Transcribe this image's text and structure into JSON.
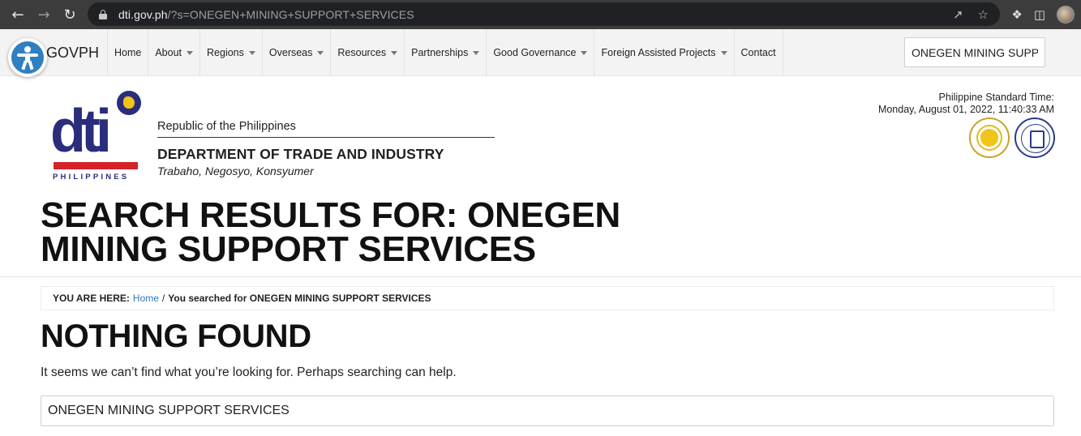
{
  "browser": {
    "url_host": "dti.gov.ph",
    "url_path": "/?s=ONEGEN+MINING+SUPPORT+SERVICES",
    "icons": [
      "back-arrow-icon",
      "forward-arrow-icon",
      "reload-icon",
      "lock-icon",
      "share-icon",
      "star-icon",
      "extensions-icon",
      "sidepanel-icon",
      "profile-avatar"
    ]
  },
  "govnav": {
    "brand": "GOVPH",
    "items": [
      {
        "label": "Home",
        "has_caret": false
      },
      {
        "label": "About",
        "has_caret": true
      },
      {
        "label": "Regions",
        "has_caret": true
      },
      {
        "label": "Overseas",
        "has_caret": true
      },
      {
        "label": "Resources",
        "has_caret": true
      },
      {
        "label": "Partnerships",
        "has_caret": true
      },
      {
        "label": "Good Governance",
        "has_caret": true
      },
      {
        "label": "Foreign Assisted Projects",
        "has_caret": true
      },
      {
        "label": "Contact",
        "has_caret": false
      }
    ],
    "search_value": "ONEGEN MINING SUPPORT SERVICES"
  },
  "header": {
    "logo_text": "dti",
    "logo_country": "PHILIPPINES",
    "republic": "Republic of the Philippines",
    "department": "DEPARTMENT OF TRADE AND INDUSTRY",
    "tagline": "Trabaho, Negosyo, Konsyumer",
    "pst_label": "Philippine Standard Time:",
    "pst_value": "Monday, August 01, 2022, 11:40:33 AM",
    "colors": {
      "navy": "#2a2d7c",
      "red": "#d3222a",
      "gold": "#f0c419"
    }
  },
  "page": {
    "title": "SEARCH RESULTS FOR: ONEGEN MINING SUPPORT SERVICES",
    "breadcrumb_prefix": "YOU ARE HERE:",
    "breadcrumb_home": "Home",
    "breadcrumb_sep": "/",
    "breadcrumb_current": "You searched for ONEGEN MINING SUPPORT SERVICES",
    "nothing_found": "NOTHING FOUND",
    "message": "It seems we can’t find what you’re looking for. Perhaps searching can help.",
    "search_value": "ONEGEN MINING SUPPORT SERVICES",
    "link_color": "#2d7bbf"
  }
}
